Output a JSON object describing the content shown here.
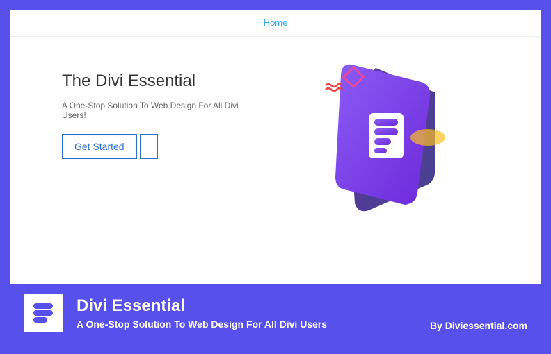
{
  "nav": {
    "home": "Home"
  },
  "hero": {
    "title": "The Divi Essential",
    "subtitle": "A One-Stop Solution To Web Design For All Divi Users!",
    "cta": "Get Started"
  },
  "footer": {
    "title": "Divi Essential",
    "subtitle": "A One-Stop Solution To Web Design For All Divi Users",
    "by": "By Diviessential.com"
  },
  "colors": {
    "frame": "#5850ec",
    "accent": "#2ea3f2",
    "btnBorder": "#2e6fcf"
  }
}
